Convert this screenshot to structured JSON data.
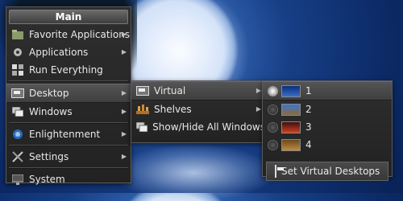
{
  "main_menu": {
    "title": "Main",
    "items": [
      {
        "label": "Favorite Applications",
        "icon": "folder-icon",
        "has_submenu": true
      },
      {
        "label": "Applications",
        "icon": "gear-icon",
        "has_submenu": true
      },
      {
        "label": "Run Everything",
        "icon": "run-icon",
        "has_submenu": false
      },
      {
        "label": "Desktop",
        "icon": "desktop-icon",
        "has_submenu": true
      },
      {
        "label": "Windows",
        "icon": "windows-icon",
        "has_submenu": true
      },
      {
        "label": "Enlightenment",
        "icon": "enlightenment-icon",
        "has_submenu": true
      },
      {
        "label": "Settings",
        "icon": "tools-icon",
        "has_submenu": true
      },
      {
        "label": "System",
        "icon": "monitor-icon",
        "has_submenu": false
      }
    ]
  },
  "desktop_submenu": {
    "items": [
      {
        "label": "Virtual",
        "icon": "desktop-icon",
        "has_submenu": true
      },
      {
        "label": "Shelves",
        "icon": "shelves-icon",
        "has_submenu": true
      },
      {
        "label": "Show/Hide All Windows",
        "icon": "windows-icon",
        "has_submenu": false
      }
    ]
  },
  "virtual_submenu": {
    "desks": [
      {
        "label": "1",
        "selected": true,
        "thumb": "blue-night"
      },
      {
        "label": "2",
        "selected": false,
        "thumb": "sky-landscape"
      },
      {
        "label": "3",
        "selected": false,
        "thumb": "red-sunset"
      },
      {
        "label": "4",
        "selected": false,
        "thumb": "autumn"
      }
    ],
    "action_label": "Set Virtual Desktops"
  },
  "colors": {
    "menu_bg": "#2a2a2a",
    "selected_bg": "#4a4a4a",
    "text": "#e8e8e8"
  }
}
